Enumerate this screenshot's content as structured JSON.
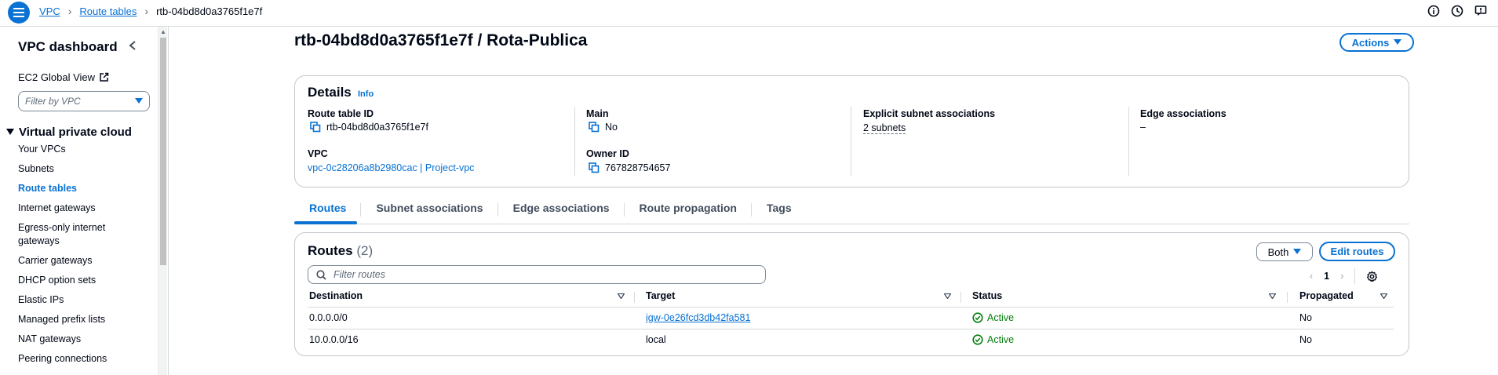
{
  "breadcrumb": {
    "items": [
      "VPC",
      "Route tables"
    ],
    "current": "rtb-04bd8d0a3765f1e7f"
  },
  "top_icons": [
    "info-icon",
    "history-icon",
    "feedback-icon"
  ],
  "sidebar": {
    "title": "VPC dashboard",
    "ec2_global_view": "EC2 Global View",
    "filter_placeholder": "Filter by VPC",
    "section": "Virtual private cloud",
    "items": [
      {
        "label": "Your VPCs",
        "active": false
      },
      {
        "label": "Subnets",
        "active": false
      },
      {
        "label": "Route tables",
        "active": true
      },
      {
        "label": "Internet gateways",
        "active": false
      },
      {
        "label": "Egress-only internet gateways",
        "active": false
      },
      {
        "label": "Carrier gateways",
        "active": false
      },
      {
        "label": "DHCP option sets",
        "active": false
      },
      {
        "label": "Elastic IPs",
        "active": false
      },
      {
        "label": "Managed prefix lists",
        "active": false
      },
      {
        "label": "NAT gateways",
        "active": false
      },
      {
        "label": "Peering connections",
        "active": false
      }
    ]
  },
  "page": {
    "title": "rtb-04bd8d0a3765f1e7f / Rota-Publica",
    "actions_label": "Actions"
  },
  "details": {
    "title": "Details",
    "info": "Info",
    "route_table_id_label": "Route table ID",
    "route_table_id": "rtb-04bd8d0a3765f1e7f",
    "main_label": "Main",
    "main": "No",
    "explicit_label": "Explicit subnet associations",
    "explicit": "2 subnets",
    "edge_label": "Edge associations",
    "edge": "–",
    "vpc_label": "VPC",
    "vpc": "vpc-0c28206a8b2980cac | Project-vpc",
    "owner_label": "Owner ID",
    "owner": "767828754657"
  },
  "tabs": [
    {
      "label": "Routes",
      "active": true
    },
    {
      "label": "Subnet associations",
      "active": false
    },
    {
      "label": "Edge associations",
      "active": false
    },
    {
      "label": "Route propagation",
      "active": false
    },
    {
      "label": "Tags",
      "active": false
    }
  ],
  "routes": {
    "title": "Routes",
    "count": "(2)",
    "both_label": "Both",
    "edit_label": "Edit routes",
    "search_placeholder": "Filter routes",
    "page": "1",
    "columns": [
      "Destination",
      "Target",
      "Status",
      "Propagated"
    ],
    "rows": [
      {
        "destination": "0.0.0.0/0",
        "target": "igw-0e26fcd3db42fa581",
        "target_is_link": true,
        "status": "Active",
        "propagated": "No"
      },
      {
        "destination": "10.0.0.0/16",
        "target": "local",
        "target_is_link": false,
        "status": "Active",
        "propagated": "No"
      }
    ]
  },
  "colors": {
    "accent": "#0972d3",
    "success": "#037f0c",
    "border": "#d5dbdb"
  }
}
